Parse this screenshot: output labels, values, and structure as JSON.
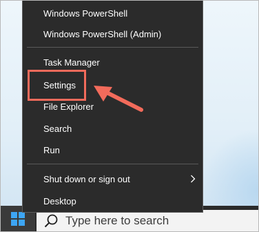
{
  "menu": {
    "items": [
      {
        "label": "Windows PowerShell"
      },
      {
        "label": "Windows PowerShell (Admin)"
      },
      {
        "label": "Task Manager"
      },
      {
        "label": "Settings"
      },
      {
        "label": "File Explorer"
      },
      {
        "label": "Search"
      },
      {
        "label": "Run"
      },
      {
        "label": "Shut down or sign out"
      },
      {
        "label": "Desktop"
      }
    ]
  },
  "taskbar": {
    "search_placeholder": "Type here to search"
  },
  "annotation": {
    "highlight_color": "#f26b5b",
    "highlighted_item": "Settings"
  },
  "colors": {
    "menu_bg": "#2b2b2b",
    "accent_windows_logo": "#3da5f4"
  },
  "icons": [
    "windows-logo-icon",
    "search-icon",
    "chevron-right-icon",
    "arrow-icon"
  ]
}
